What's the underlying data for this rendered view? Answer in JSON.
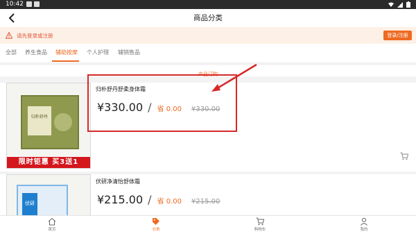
{
  "status_bar": {
    "time": "10:42"
  },
  "header": {
    "title": "商品分类"
  },
  "login_bar": {
    "message": "请先登录或注册",
    "button_label": "登录/注册"
  },
  "tabs": [
    {
      "label": "全部",
      "active": false
    },
    {
      "label": "养生食品",
      "active": false
    },
    {
      "label": "辅助按摩",
      "active": true
    },
    {
      "label": "个人护理",
      "active": false
    },
    {
      "label": "辅销售品",
      "active": false
    }
  ],
  "section": {
    "title": "产品订购"
  },
  "products": [
    {
      "name": "归朴舒丹舒柔身体霜",
      "price": "¥330.00",
      "slash": "/",
      "save_text": "省 0.00",
      "original_price": "¥330.00",
      "promo_banner": "限时钜惠 买3送1",
      "package_text": "归朴舒丹"
    },
    {
      "name": "伏研净清怡舒体霜",
      "price": "¥215.00",
      "slash": "/",
      "save_text": "省 0.00",
      "original_price": "¥215.00",
      "package_text": "伏研"
    }
  ],
  "bottom_nav": [
    {
      "label": "首页",
      "icon": "home-icon",
      "active": false
    },
    {
      "label": "分类",
      "icon": "tag-icon",
      "active": true
    },
    {
      "label": "购物车",
      "icon": "cart-icon",
      "active": false
    },
    {
      "label": "我的",
      "icon": "user-icon",
      "active": false
    }
  ],
  "colors": {
    "accent": "#ee6a21",
    "annotation": "#d62828",
    "promo_red": "#d4161d"
  }
}
